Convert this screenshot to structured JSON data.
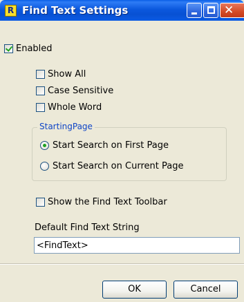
{
  "window": {
    "title": "Find Text Settings",
    "app_icon_letter": "R"
  },
  "titlebar": {
    "close_glyph": "✕"
  },
  "options": {
    "enabled": {
      "label": "Enabled",
      "checked": true
    },
    "show_all": {
      "label": "Show All",
      "checked": false
    },
    "case_sensitive": {
      "label": "Case Sensitive",
      "checked": false
    },
    "whole_word": {
      "label": "Whole Word",
      "checked": false
    },
    "show_toolbar": {
      "label": "Show the Find Text Toolbar",
      "checked": false
    }
  },
  "starting_page": {
    "legend": "StartingPage",
    "first_page": {
      "label": "Start Search on First Page",
      "selected": true
    },
    "current_page": {
      "label": "Start Search on Current Page",
      "selected": false
    }
  },
  "default_string": {
    "label": "Default Find Text String",
    "value": "<FindText>"
  },
  "buttons": {
    "ok": "OK",
    "cancel": "Cancel"
  }
}
